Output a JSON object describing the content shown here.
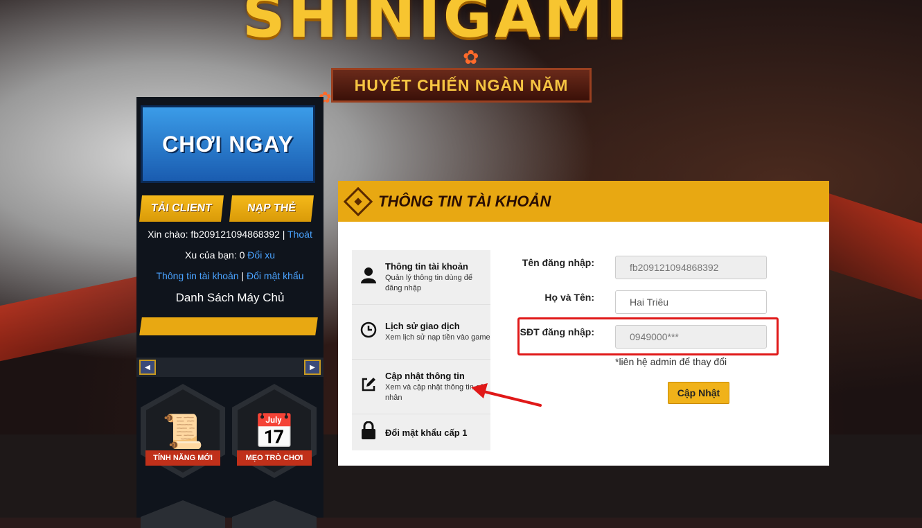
{
  "header": {
    "logo_text": "SHINIGAMI",
    "subtitle": "HUYẾT CHIẾN NGÀN NĂM"
  },
  "sidebar": {
    "play_label": "CHƠI NGAY",
    "client_label": "TẢI CLIENT",
    "topup_label": "NẠP THẺ",
    "greeting": "Xin chào: fb209121094868392 |",
    "logout_label": "Thoát",
    "coins_text": "Xu của bạn: 0",
    "exchange_label": "Đổi xu",
    "account_link": "Thông tin tài khoản",
    "separator": "|",
    "password_link": "Đổi mật khẩu",
    "server_list_title": "Danh Sách Máy Chủ",
    "tiles": [
      {
        "label": "TÍNH NĂNG MỚI",
        "icon": "scroll-icon"
      },
      {
        "label": "MẸO TRÒ CHƠI",
        "icon": "calendar-icon"
      }
    ]
  },
  "panel": {
    "title": "THÔNG TIN TÀI KHOẢN",
    "menu": [
      {
        "title": "Thông tin tài khoản",
        "desc": "Quản lý thông tin dùng để đăng nhập",
        "icon": "user-icon"
      },
      {
        "title": "Lịch sử giao dịch",
        "desc": "Xem lịch sử nạp tiền vào game",
        "icon": "clock-icon"
      },
      {
        "title": "Cập nhật thông tin",
        "desc": "Xem và cập nhật thông tin cá nhân",
        "icon": "edit-icon"
      },
      {
        "title": "Đổi mật khẩu cấp 1",
        "desc": "",
        "icon": "lock-icon"
      }
    ],
    "form": {
      "username_label": "Tên đăng nhập:",
      "username_value": "fb209121094868392",
      "fullname_label": "Họ và Tên:",
      "fullname_value": "Hai Triêu",
      "phone_label": "SĐT đăng nhập:",
      "phone_value": "0949000***",
      "note": "*liên hệ admin để thay đổi",
      "submit_label": "Cập Nhật"
    }
  },
  "colors": {
    "accent": "#e8a812",
    "link": "#4aa3ff",
    "highlight": "#e01818"
  }
}
